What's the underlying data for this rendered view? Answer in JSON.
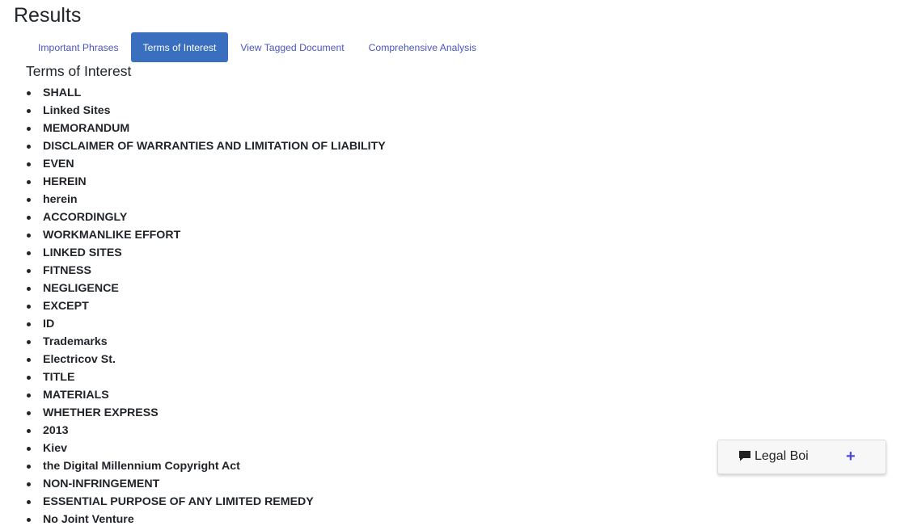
{
  "page": {
    "title": "Results"
  },
  "tabs": [
    {
      "label": "Important Phrases",
      "active": false
    },
    {
      "label": "Terms of Interest",
      "active": true
    },
    {
      "label": "View Tagged Document",
      "active": false
    },
    {
      "label": "Comprehensive Analysis",
      "active": false
    }
  ],
  "section": {
    "heading": "Terms of Interest"
  },
  "terms": [
    "SHALL",
    "Linked Sites",
    "MEMORANDUM",
    "DISCLAIMER OF WARRANTIES AND LIMITATION OF LIABILITY",
    "EVEN",
    "HEREIN",
    "herein",
    "ACCORDINGLY",
    "WORKMANLIKE EFFORT",
    "LINKED SITES",
    "FITNESS",
    "NEGLIGENCE",
    "EXCEPT",
    "ID",
    "Trademarks",
    "Electricov St.",
    "TITLE",
    "MATERIALS",
    "WHETHER EXPRESS",
    "2013",
    "Kiev",
    "the Digital Millennium Copyright Act",
    "NON-INFRINGEMENT",
    "ESSENTIAL PURPOSE OF ANY LIMITED REMEDY",
    "No Joint Venture"
  ],
  "chat": {
    "title": "Legal Boi",
    "expand_label": "+",
    "icon": "comment-icon"
  },
  "colors": {
    "active_tab_bg": "#3a6fc0",
    "tab_link": "#4a55c2",
    "plus": "#4a4ad8"
  }
}
